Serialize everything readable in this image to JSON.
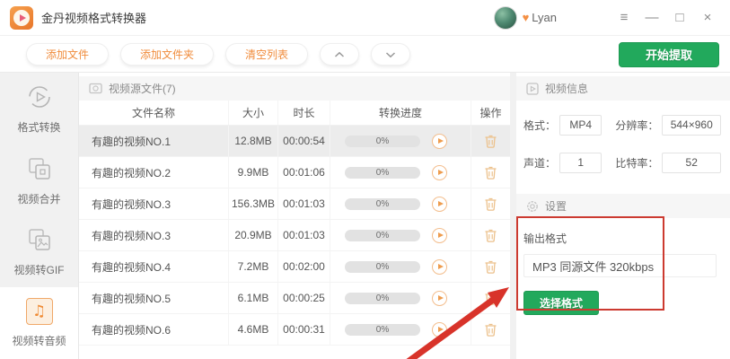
{
  "titlebar": {
    "app_title": "金丹视频格式转换器",
    "user_name": "Lyan",
    "heart_icon": "♥",
    "menu_icon": "≡",
    "minimize_icon": "—",
    "maximize_icon": "□",
    "close_icon": "×"
  },
  "toolbar": {
    "add_file": "添加文件",
    "add_folder": "添加文件夹",
    "clear_list": "清空列表",
    "start_extract": "开始提取"
  },
  "sidebar": {
    "items": [
      {
        "label": "格式转换"
      },
      {
        "label": "视频合并"
      },
      {
        "label": "视频转GIF"
      },
      {
        "label": "视频转音频",
        "active": true
      }
    ],
    "music_note_icon": "♫"
  },
  "table": {
    "section_title": "视频源文件(7)",
    "columns": [
      "文件名称",
      "大小",
      "时长",
      "转换进度",
      "操作"
    ],
    "rows": [
      {
        "name": "有趣的视频NO.1",
        "size": "12.8MB",
        "duration": "00:00:54",
        "progress": "0%",
        "selected": true
      },
      {
        "name": "有趣的视频NO.2",
        "size": "9.9MB",
        "duration": "00:01:06",
        "progress": "0%"
      },
      {
        "name": "有趣的视频NO.3",
        "size": "156.3MB",
        "duration": "00:01:03",
        "progress": "0%"
      },
      {
        "name": "有趣的视频NO.3",
        "size": "20.9MB",
        "duration": "00:01:03",
        "progress": "0%"
      },
      {
        "name": "有趣的视频NO.4",
        "size": "7.2MB",
        "duration": "00:02:00",
        "progress": "0%"
      },
      {
        "name": "有趣的视频NO.5",
        "size": "6.1MB",
        "duration": "00:00:25",
        "progress": "0%"
      },
      {
        "name": "有趣的视频NO.6",
        "size": "4.6MB",
        "duration": "00:00:31",
        "progress": "0%"
      }
    ]
  },
  "info_panel": {
    "section_title": "视频信息",
    "format_label": "格式：",
    "format_value": "MP4",
    "resolution_label": "分辨率：",
    "resolution_value": "544×960",
    "channels_label": "声道：",
    "channels_value": "1",
    "bitrate_label": "比特率：",
    "bitrate_value": "52"
  },
  "settings_panel": {
    "section_title": "设置",
    "output_format_label": "输出格式",
    "output_format_value": "MP3 同源文件 320kbps",
    "choose_format_button": "选择格式"
  },
  "colors": {
    "accent_orange": "#f08c3c",
    "primary_green": "#22a95c",
    "annotation_red": "#cc3a30"
  }
}
